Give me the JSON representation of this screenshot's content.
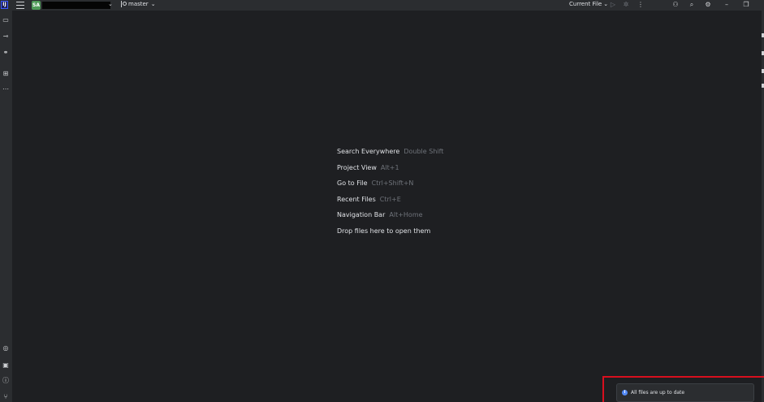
{
  "titlebar": {
    "app_logo": "IJ",
    "project_badge": "SA",
    "branch": "master",
    "run_config": "Current File",
    "icons": [
      "run-icon",
      "debug-icon",
      "more-icon",
      "add-user-icon",
      "search-icon",
      "settings-icon",
      "minimize-icon",
      "restore-icon"
    ]
  },
  "left_strip": {
    "icons": [
      "folder-icon",
      "commit-icon",
      "git-icon",
      "structure-icon",
      "more-icon",
      "services-icon",
      "terminal-icon",
      "problems-icon",
      "version-control-icon"
    ]
  },
  "hints": [
    {
      "label": "Search Everywhere",
      "shortcut": "Double Shift"
    },
    {
      "label": "Project View",
      "shortcut": "Alt+1"
    },
    {
      "label": "Go to File",
      "shortcut": "Ctrl+Shift+N"
    },
    {
      "label": "Recent Files",
      "shortcut": "Ctrl+E"
    },
    {
      "label": "Navigation Bar",
      "shortcut": "Alt+Home"
    },
    {
      "label": "Drop files here to open them",
      "shortcut": ""
    }
  ],
  "notification": {
    "text": "All files are up to date"
  },
  "colors": {
    "editor_bg": "#1e1f22",
    "panel_bg": "#2b2d30",
    "highlight": "#d80f1e",
    "info": "#548af7"
  }
}
